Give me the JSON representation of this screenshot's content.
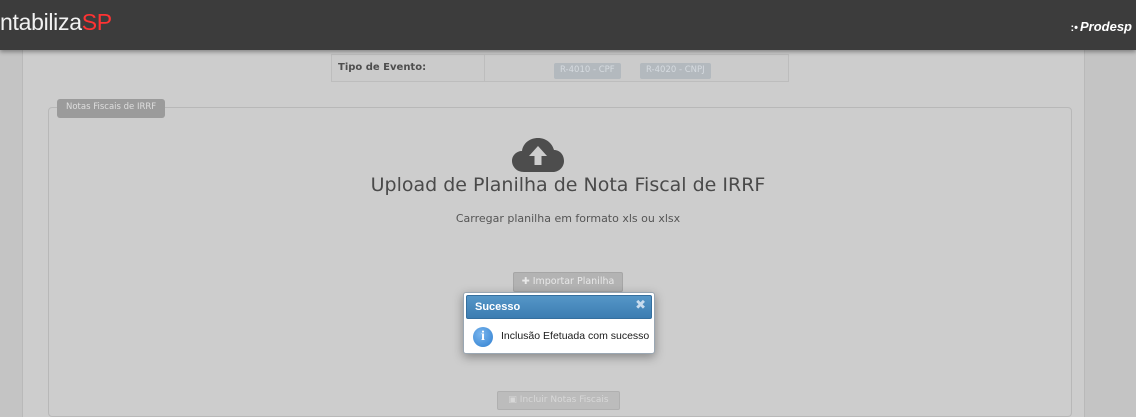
{
  "header": {
    "brand_prefix": "ntabiliza",
    "brand_suffix": "SP",
    "partner_logo": "Prodesp",
    "partner_mark": ":•"
  },
  "evento": {
    "label": "Tipo de Evento:",
    "options": [
      "R-4010 - CPF",
      "R-4020 - CNPJ"
    ]
  },
  "panel": {
    "tab_label": "Notas Fiscais de IRRF",
    "upload_icon": "cloud-upload-icon",
    "title": "Upload de Planilha de Nota Fiscal de IRRF",
    "subtitle": "Carregar planilha em formato xls ou xlsx",
    "import_button": "Importar Planilha",
    "import_icon": "plus-icon",
    "include_button": "Incluir Notas Fiscais",
    "include_icon": "save-icon"
  },
  "dialog": {
    "title": "Sucesso",
    "close_icon": "close-icon",
    "icon": "info-icon",
    "message": "Inclusão Efetuada com sucesso"
  },
  "colors": {
    "topbar": "#3c3c3c",
    "brand_accent": "#ff3333",
    "dialog_header": "#4a8bbf"
  }
}
